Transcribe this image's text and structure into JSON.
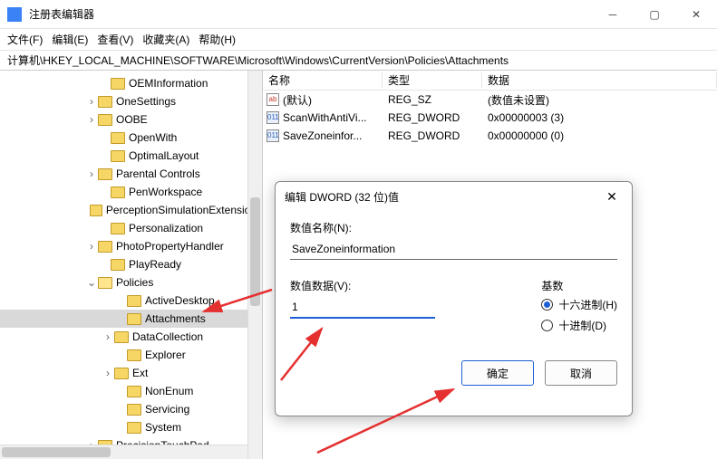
{
  "window": {
    "title": "注册表编辑器"
  },
  "menu": {
    "file": "文件(F)",
    "edit": "编辑(E)",
    "view": "查看(V)",
    "fav": "收藏夹(A)",
    "help": "帮助(H)"
  },
  "address": "计算机\\HKEY_LOCAL_MACHINE\\SOFTWARE\\Microsoft\\Windows\\CurrentVersion\\Policies\\Attachments",
  "tree": [
    {
      "indent": 108,
      "exp": "",
      "label": "OEMInformation"
    },
    {
      "indent": 94,
      "exp": "›",
      "label": "OneSettings"
    },
    {
      "indent": 94,
      "exp": "›",
      "label": "OOBE"
    },
    {
      "indent": 108,
      "exp": "",
      "label": "OpenWith"
    },
    {
      "indent": 108,
      "exp": "",
      "label": "OptimalLayout"
    },
    {
      "indent": 94,
      "exp": "›",
      "label": "Parental Controls"
    },
    {
      "indent": 108,
      "exp": "",
      "label": "PenWorkspace"
    },
    {
      "indent": 108,
      "exp": "",
      "label": "PerceptionSimulationExtensions"
    },
    {
      "indent": 108,
      "exp": "",
      "label": "Personalization"
    },
    {
      "indent": 94,
      "exp": "›",
      "label": "PhotoPropertyHandler"
    },
    {
      "indent": 108,
      "exp": "",
      "label": "PlayReady"
    },
    {
      "indent": 94,
      "exp": "⌄",
      "label": "Policies",
      "open": true
    },
    {
      "indent": 126,
      "exp": "",
      "label": "ActiveDesktop"
    },
    {
      "indent": 126,
      "exp": "",
      "label": "Attachments",
      "selected": true
    },
    {
      "indent": 112,
      "exp": "›",
      "label": "DataCollection"
    },
    {
      "indent": 126,
      "exp": "",
      "label": "Explorer"
    },
    {
      "indent": 112,
      "exp": "›",
      "label": "Ext"
    },
    {
      "indent": 126,
      "exp": "",
      "label": "NonEnum"
    },
    {
      "indent": 126,
      "exp": "",
      "label": "Servicing"
    },
    {
      "indent": 126,
      "exp": "",
      "label": "System"
    },
    {
      "indent": 94,
      "exp": "›",
      "label": "PrecisionTouchPad"
    }
  ],
  "columns": {
    "name": "名称",
    "type": "类型",
    "data": "数据"
  },
  "values": [
    {
      "icon": "sz",
      "iconText": "ab",
      "name": "(默认)",
      "type": "REG_SZ",
      "data": "(数值未设置)"
    },
    {
      "icon": "dw",
      "iconText": "011",
      "name": "ScanWithAntiVi...",
      "type": "REG_DWORD",
      "data": "0x00000003 (3)"
    },
    {
      "icon": "dw",
      "iconText": "011",
      "name": "SaveZoneinfor...",
      "type": "REG_DWORD",
      "data": "0x00000000 (0)"
    }
  ],
  "dialog": {
    "title": "编辑 DWORD (32 位)值",
    "name_label": "数值名称(N):",
    "name_value": "SaveZoneinformation",
    "data_label": "数值数据(V):",
    "data_value": "1",
    "base_label": "基数",
    "radio_hex": "十六进制(H)",
    "radio_dec": "十进制(D)",
    "ok": "确定",
    "cancel": "取消"
  }
}
